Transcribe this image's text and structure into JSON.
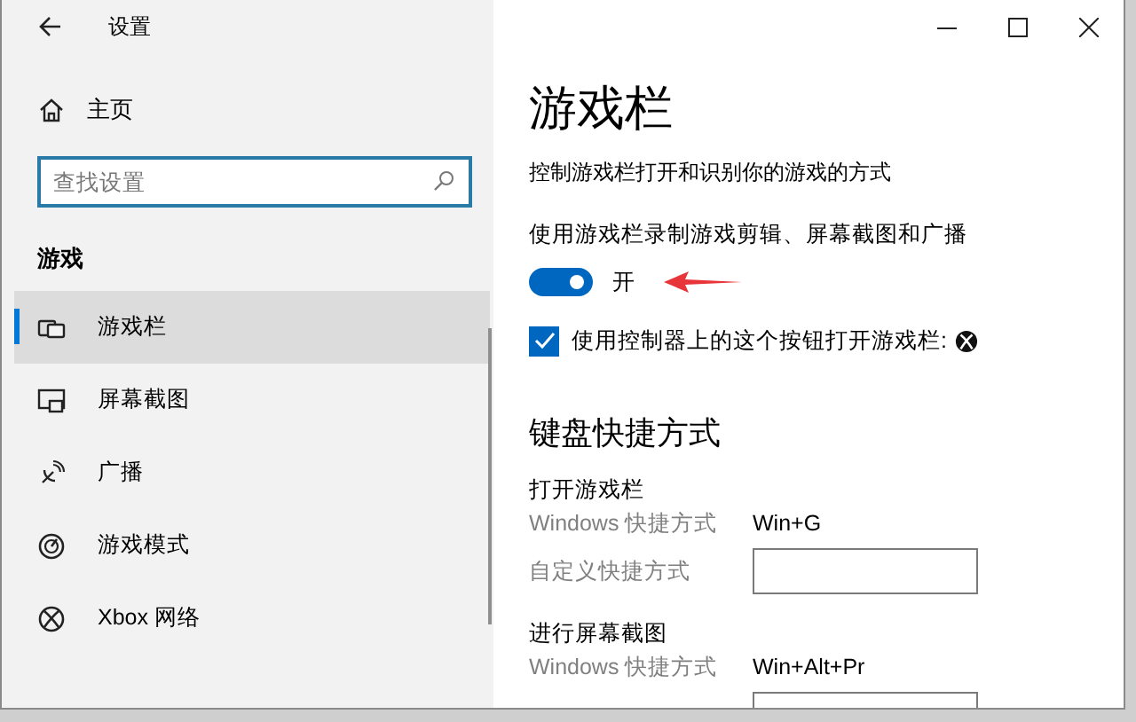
{
  "window": {
    "title": "设置"
  },
  "sidebar": {
    "home": "主页",
    "search": {
      "placeholder": "查找设置"
    },
    "section": "游戏",
    "items": [
      {
        "label": "游戏栏",
        "kind": "gamebar",
        "selected": true
      },
      {
        "label": "屏幕截图",
        "kind": "capture",
        "selected": false
      },
      {
        "label": "广播",
        "kind": "broadcast",
        "selected": false
      },
      {
        "label": "游戏模式",
        "kind": "gamemode",
        "selected": false
      },
      {
        "label": "Xbox 网络",
        "kind": "xbox",
        "selected": false
      }
    ]
  },
  "content": {
    "title": "游戏栏",
    "description": "控制游戏栏打开和识别你的游戏的方式",
    "toggle_label": "使用游戏栏录制游戏剪辑、屏幕截图和广播",
    "toggle": {
      "on": true,
      "state_label": "开"
    },
    "checkbox": {
      "checked": true,
      "label": "使用控制器上的这个按钮打开游戏栏:"
    },
    "shortcuts_title": "键盘快捷方式",
    "groups": [
      {
        "title": "打开游戏栏",
        "rows": [
          {
            "kind": "value",
            "label": "Windows 快捷方式",
            "value": "Win+G"
          },
          {
            "kind": "field",
            "label": "自定义快捷方式"
          }
        ]
      },
      {
        "title": "进行屏幕截图",
        "rows": [
          {
            "kind": "value",
            "label": "Windows 快捷方式",
            "value": "Win+Alt+Pr"
          },
          {
            "kind": "field"
          }
        ]
      }
    ]
  }
}
